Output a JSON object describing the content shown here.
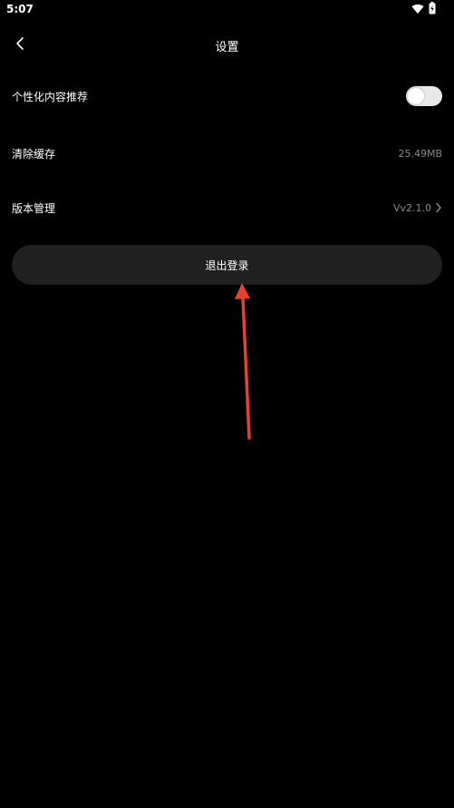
{
  "status_bar": {
    "time": "5:07",
    "icons": [
      "wifi-icon",
      "battery-icon"
    ]
  },
  "header": {
    "title": "设置",
    "back_icon": "chevron-left-icon"
  },
  "settings": {
    "personalized": {
      "label": "个性化内容推荐",
      "enabled": false
    },
    "clear_cache": {
      "label": "清除缓存",
      "value": "25.49MB"
    },
    "version": {
      "label": "版本管理",
      "value": "Vv2.1.0",
      "icon": "chevron-right-icon"
    }
  },
  "logout": {
    "label": "退出登录"
  },
  "colors": {
    "background": "#000000",
    "text": "#ffffff",
    "muted_text": "#8a8a8a",
    "button_bg": "#202020",
    "toggle_track": "#e8e8e8",
    "annotation_arrow": "#e8412f"
  }
}
